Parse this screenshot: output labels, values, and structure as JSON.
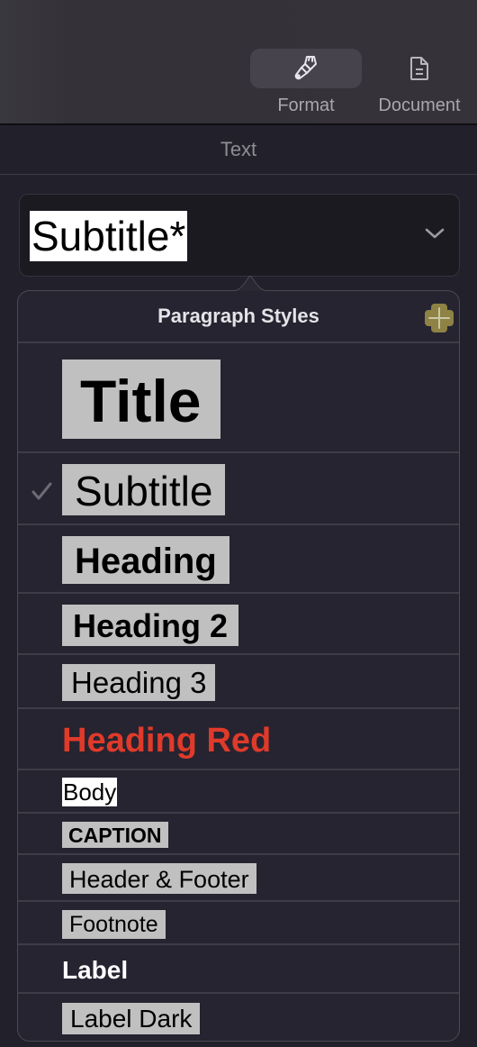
{
  "toolbar": {
    "format_label": "Format",
    "document_label": "Document"
  },
  "section": {
    "title": "Text"
  },
  "paragraph_style_popup": {
    "value": "Subtitle*"
  },
  "menu": {
    "title": "Paragraph Styles",
    "add_icon_color": "#8e8245",
    "selected": "Subtitle",
    "items": [
      {
        "label": "Title"
      },
      {
        "label": "Subtitle"
      },
      {
        "label": "Heading"
      },
      {
        "label": "Heading 2"
      },
      {
        "label": "Heading 3"
      },
      {
        "label": "Heading Red",
        "color": "#e03a2a"
      },
      {
        "label": "Body"
      },
      {
        "label": "CAPTION"
      },
      {
        "label": "Header & Footer"
      },
      {
        "label": "Footnote"
      },
      {
        "label": "Label"
      },
      {
        "label": "Label Dark"
      }
    ]
  }
}
